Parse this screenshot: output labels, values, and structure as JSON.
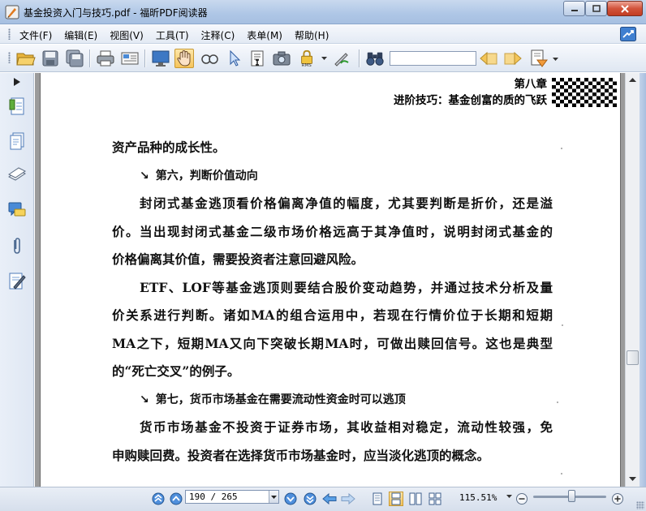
{
  "window": {
    "title": "基金投资入门与技巧.pdf - 福昕PDF阅读器"
  },
  "menu": {
    "items": [
      {
        "label": "文件(F)"
      },
      {
        "label": "编辑(E)"
      },
      {
        "label": "视图(V)"
      },
      {
        "label": "工具(T)"
      },
      {
        "label": "注释(C)"
      },
      {
        "label": "表单(M)"
      },
      {
        "label": "帮助(H)"
      }
    ]
  },
  "toolbar": {
    "icons": [
      "open-folder-icon",
      "save-icon",
      "save-as-icon",
      "print-icon",
      "email-icon",
      "fullscreen-icon",
      "hand-tool-icon",
      "zoom-tool-icon",
      "select-arrow-icon",
      "select-text-icon",
      "snapshot-icon",
      "rms-lock-icon",
      "sign-icon",
      "binoculars-icon",
      "find-prev-icon",
      "find-next-icon",
      "highlight-icon"
    ],
    "active_tool": "hand-tool-icon",
    "find_value": ""
  },
  "document": {
    "chapter_number": "第八章",
    "chapter_title": "进阶技巧：基金创富的质的飞跃",
    "lines": [
      {
        "text": "资产品种的成长性。",
        "type": "last"
      },
      {
        "text": "第六，判断价值动向",
        "type": "heading"
      },
      {
        "text": "封闭式基金逃顶看价格偏离净值的幅度，尤其要判断是折价，还是溢",
        "type": "indent"
      },
      {
        "text": "价。当出现封闭式基金二级市场价格远高于其净值时，说明封闭式基金的",
        "type": "full"
      },
      {
        "text": "价格偏离其价值，需要投资者注意回避风险。",
        "type": "last"
      },
      {
        "text": "ETF、LOF等基金逃顶则要结合股价变动趋势，并通过技术分析及量",
        "type": "indent"
      },
      {
        "text": "价关系进行判断。诸如MA的组合运用中，若现在行情价位于长期和短期",
        "type": "full"
      },
      {
        "text": "MA之下，短期MA又向下突破长期MA时，可做出赎回信号。这也是典型",
        "type": "full"
      },
      {
        "text": "的“死亡交叉”的例子。",
        "type": "last"
      },
      {
        "text": "第七，货币市场基金在需要流动性资金时可以逃顶",
        "type": "heading"
      },
      {
        "text": "货币市场基金不投资于证券市场，其收益相对稳定，流动性较强，免",
        "type": "indent"
      },
      {
        "text": "申购赎回费。投资者在选择货币市场基金时，应当淡化逃顶的概念。",
        "type": "last"
      }
    ],
    "heading_marker": "↘"
  },
  "status": {
    "page_display": "190 / 265",
    "current_page": 190,
    "total_pages": 265,
    "zoom_label": "115.51%",
    "zoom_slider_fraction": 0.5
  },
  "colors": {
    "titlebar": "#aec6e6",
    "doc_background": "#9b9b9b",
    "active_tool": "#f6c45c"
  }
}
